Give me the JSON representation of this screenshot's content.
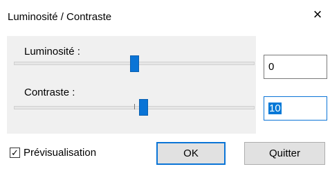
{
  "window": {
    "title": "Luminosité / Contraste",
    "close_glyph": "×",
    "close_icon": "close-icon"
  },
  "brightness": {
    "label": "Luminosité :",
    "value": "0",
    "slider_fraction": 0.5
  },
  "contrast": {
    "label": "Contraste :",
    "value": "10",
    "slider_fraction": 0.54
  },
  "preview": {
    "label": "Prévisualisation",
    "checked": true,
    "check_glyph": "✓"
  },
  "buttons": {
    "ok": "OK",
    "quit": "Quitter"
  },
  "colors": {
    "accent": "#0a74d6",
    "selection": "#0078d7"
  }
}
